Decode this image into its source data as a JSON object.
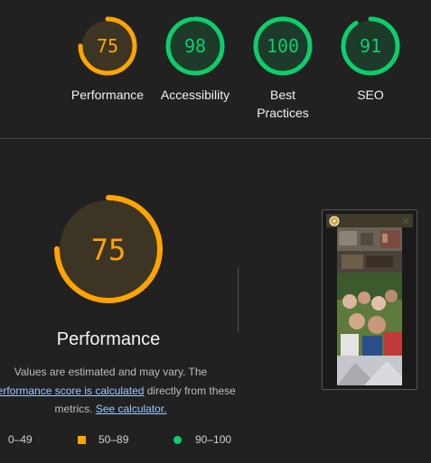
{
  "summary": [
    {
      "score": "75",
      "label": "Performance",
      "color": "#ffa400",
      "bg": "#3c3524",
      "value": 75
    },
    {
      "score": "98",
      "label": "Accessibility",
      "color": "#0cce6b",
      "bg": "#1e3a2b",
      "value": 98
    },
    {
      "score": "100",
      "label": "Best Practices",
      "color": "#0cce6b",
      "bg": "#1e3a2b",
      "value": 100
    },
    {
      "score": "91",
      "label": "SEO",
      "color": "#0cce6b",
      "bg": "#1e3a2b",
      "value": 91
    }
  ],
  "detail": {
    "score": "75",
    "title": "Performance",
    "note_line1": "Values are estimated and may vary. The",
    "note_link1": "performance score is calculated",
    "note_line2_rest": " directly from these",
    "note_line3_pre": "metrics. ",
    "note_link2": "See calculator."
  },
  "legend": [
    {
      "range": "0–49",
      "color": "#ff4e42",
      "shape": "triangle"
    },
    {
      "range": "50–89",
      "color": "#ffa400",
      "shape": "square"
    },
    {
      "range": "90–100",
      "color": "#0cce6b",
      "shape": "circle"
    }
  ],
  "colors": {
    "background": "#212121",
    "pass": "#0cce6b",
    "average": "#ffa400"
  }
}
